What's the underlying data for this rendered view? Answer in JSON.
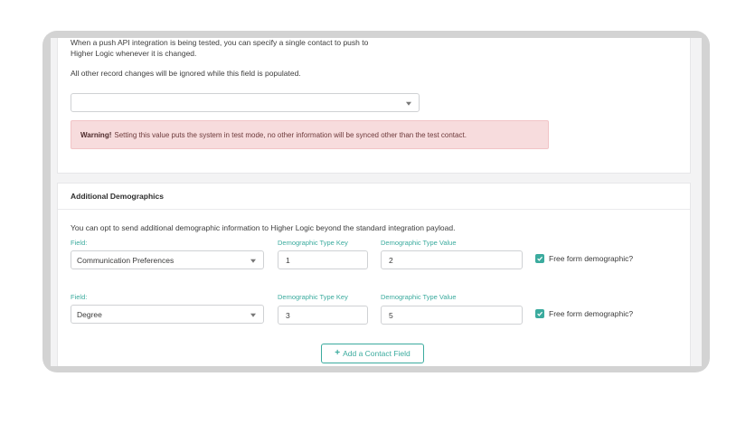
{
  "test_contact": {
    "description_line1": "When a push API integration is being tested, you can specify a single contact to push to",
    "description_line2": "Higher Logic whenever it is changed.",
    "ignore_note": "All other record changes will be ignored while this field is populated.",
    "select_value": "",
    "warning_strong": "Warning!",
    "warning_text": "Setting this value puts the system in test mode, no other information will be synced other than the test contact."
  },
  "demographics": {
    "title": "Additional Demographics",
    "intro": "You can opt to send additional demographic information to Higher Logic beyond the standard integration payload.",
    "rows": [
      {
        "field_label": "Field:",
        "field_value": "Communication Preferences",
        "key_label": "Demographic Type Key",
        "key_value": "1",
        "value_label": "Demographic Type Value",
        "value_value": "2",
        "free_form_label": "Free form demographic?",
        "free_form_checked": true
      },
      {
        "field_label": "Field:",
        "field_value": "Degree",
        "key_label": "Demographic Type Key",
        "key_value": "3",
        "value_label": "Demographic Type Value",
        "value_value": "5",
        "free_form_label": "Free form demographic?",
        "free_form_checked": true
      }
    ],
    "add_button_label": "Add a Contact Field"
  },
  "colors": {
    "accent": "#3bab9e",
    "warning_bg": "#f7dcdd",
    "frame": "#d3d3d3"
  }
}
